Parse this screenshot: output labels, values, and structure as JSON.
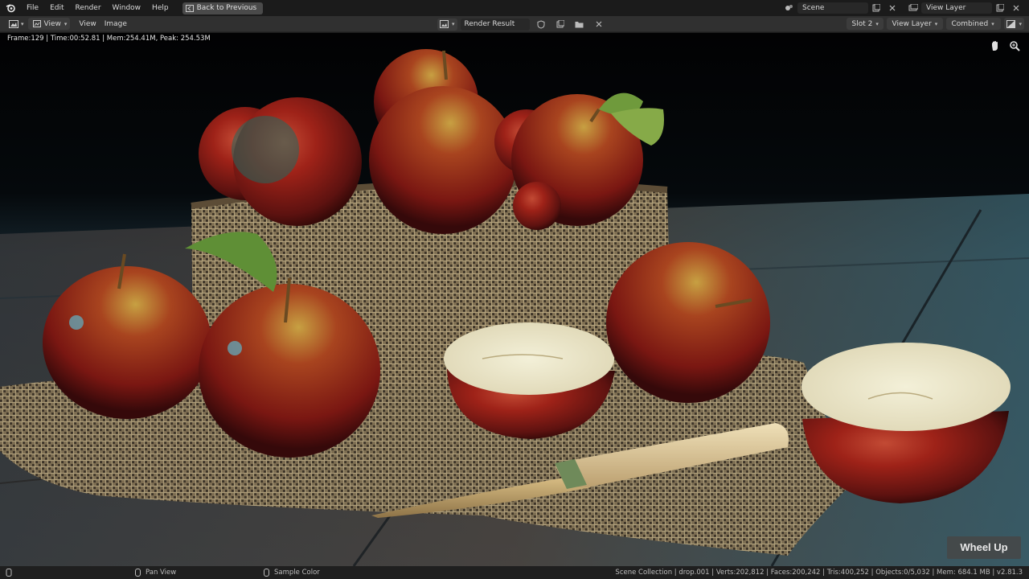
{
  "menu": {
    "items": [
      "File",
      "Edit",
      "Render",
      "Window",
      "Help"
    ],
    "back_button": "Back to Previous"
  },
  "top_right": {
    "scene": "Scene",
    "view_layer": "View Layer"
  },
  "header": {
    "view_menu": "View",
    "view": "View",
    "image": "Image",
    "image_name": "Render Result",
    "slot": "Slot 2",
    "layer": "View Layer",
    "pass": "Combined"
  },
  "frame_info": "Frame:129 | Time:00:52.81 | Mem:254.41M, Peak: 254.53M",
  "overlay": {
    "wheel_up": "Wheel Up"
  },
  "status": {
    "hint1": "Pan View",
    "hint2": "Sample Color",
    "stats": "Scene Collection | drop.001 | Verts:202,812 | Faces:200,242 | Tris:400,252 | Objects:0/5,032 | Mem: 684.1 MB | v2.81.3"
  },
  "colors": {
    "topbar": "#1b1b1b",
    "header": "#303030",
    "accent_apple": "#8e1a16",
    "burlap": "#9c8a68",
    "wood": "#3f5660"
  }
}
